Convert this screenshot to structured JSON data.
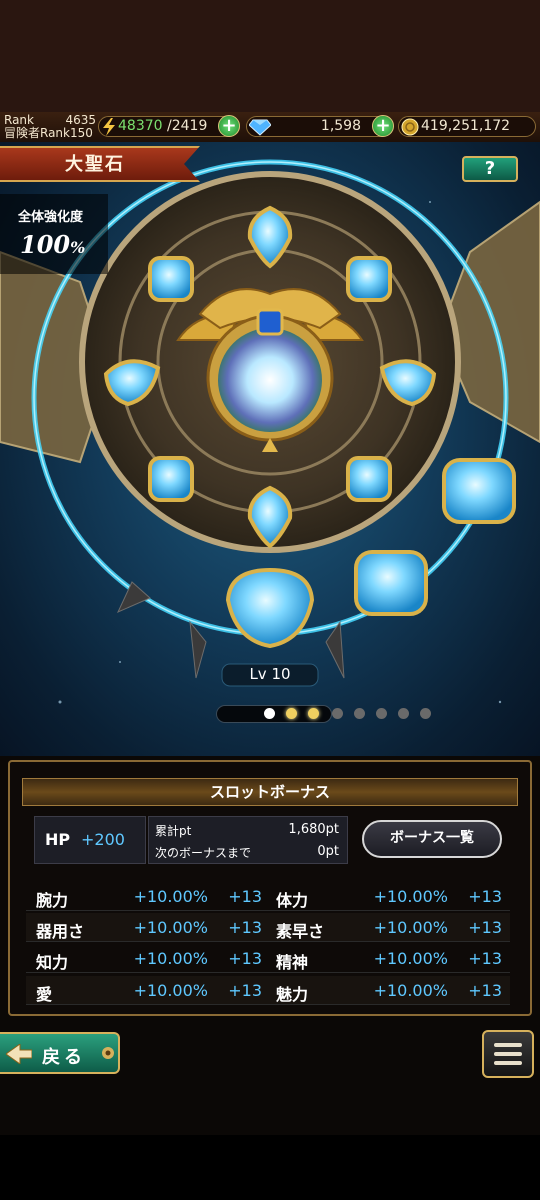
{
  "hud": {
    "rank_label": "Rank",
    "rank_value": "4635",
    "adventurer_rank_label": "冒険者Rank",
    "adventurer_rank_value": "150",
    "stamina_current": "48370",
    "stamina_max": "/2419",
    "gems": "1,598",
    "gold": "419,251,172"
  },
  "screen": {
    "title": "大聖石",
    "help_label": "?",
    "overall_enhancement_label": "全体強化度",
    "overall_enhancement_value": "100",
    "overall_enhancement_unit": "%",
    "level_label": "Lv 10",
    "page_count": 8,
    "current_page": 1
  },
  "bonus_panel": {
    "header": "スロットボーナス",
    "hp_label": "HP",
    "hp_value": "+200",
    "cumulative_label": "累計pt",
    "cumulative_value": "1,680pt",
    "next_bonus_label": "次のボーナスまで",
    "next_bonus_value": "0pt",
    "bonus_list_button": "ボーナス一覧",
    "stats": [
      {
        "left_name": "腕力",
        "left_pct": "+10.00%",
        "left_add": "+13",
        "right_name": "体力",
        "right_pct": "+10.00%",
        "right_add": "+13"
      },
      {
        "left_name": "器用さ",
        "left_pct": "+10.00%",
        "left_add": "+13",
        "right_name": "素早さ",
        "right_pct": "+10.00%",
        "right_add": "+13"
      },
      {
        "left_name": "知力",
        "left_pct": "+10.00%",
        "left_add": "+13",
        "right_name": "精神",
        "right_pct": "+10.00%",
        "right_add": "+13"
      },
      {
        "left_name": "愛",
        "left_pct": "+10.00%",
        "left_add": "+13",
        "right_name": "魅力",
        "right_pct": "+10.00%",
        "right_add": "+13"
      }
    ]
  },
  "footer": {
    "back_label": "戻る"
  },
  "icons": {
    "stamina": "lightning-icon",
    "gem": "diamond-icon",
    "gold": "coin-icon"
  },
  "colors": {
    "accent_blue": "#5fc8ff",
    "gold_border": "#d6b15c",
    "banner_red": "#a9381c",
    "green_button": "#1f8a5e"
  }
}
